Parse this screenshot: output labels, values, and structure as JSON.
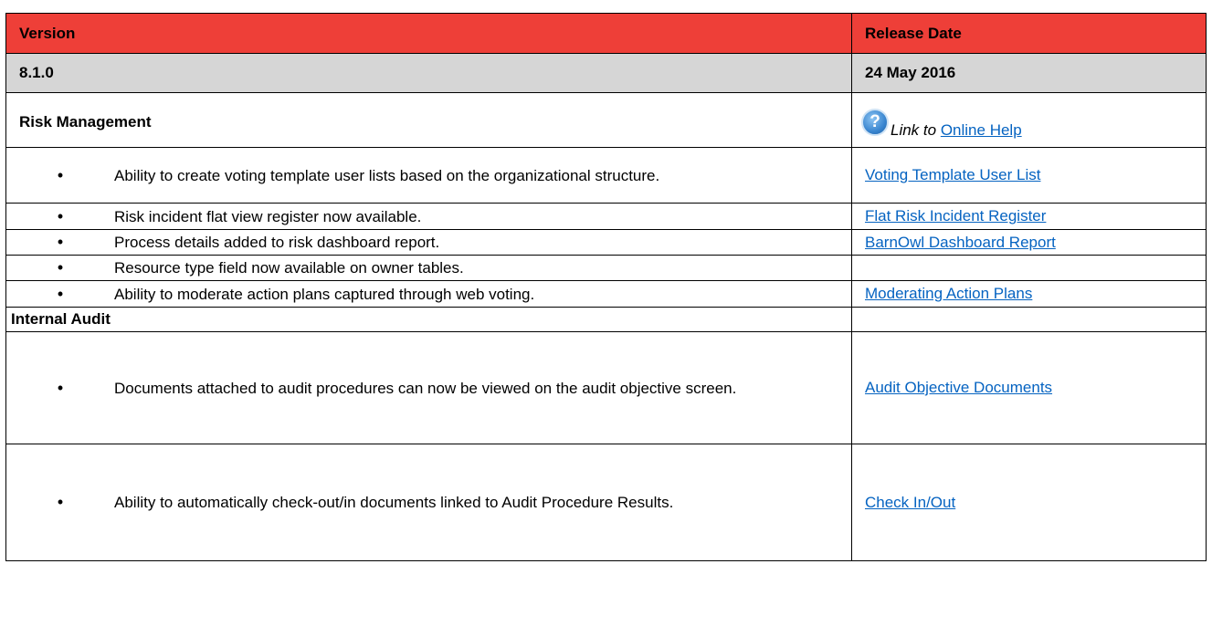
{
  "header": {
    "col1": "Version",
    "col2": "Release Date"
  },
  "release": {
    "version": "8.1.0",
    "date": "24 May 2016"
  },
  "risk_section": {
    "title": "Risk Management",
    "help_prefix": "Link to",
    "help_link": "Online Help",
    "help_icon": "question-mark-icon"
  },
  "risk_items": [
    {
      "text": "Ability to create voting template user lists based on the organizational structure.",
      "link": "Voting Template User List"
    },
    {
      "text": "Risk incident flat view register now available.",
      "link": "Flat Risk Incident Register"
    },
    {
      "text": "Process details added to risk dashboard report.",
      "link": "BarnOwl Dashboard Report"
    },
    {
      "text": "Resource type field now available on owner tables.",
      "link": ""
    },
    {
      "text": "Ability to moderate action plans captured through web voting.",
      "link": "Moderating Action Plans"
    }
  ],
  "audit_section": {
    "title": "Internal Audit"
  },
  "audit_items": [
    {
      "text": "Documents attached to audit procedures can now be viewed on the audit objective screen.",
      "link": "Audit Objective Documents"
    },
    {
      "text": "Ability to automatically check-out/in documents linked to Audit Procedure Results.",
      "link": "Check In/Out"
    }
  ],
  "colors": {
    "header_bg": "#ee3f38",
    "version_bg": "#d6d6d6",
    "link": "#0563c1"
  },
  "bullet_char": "•"
}
